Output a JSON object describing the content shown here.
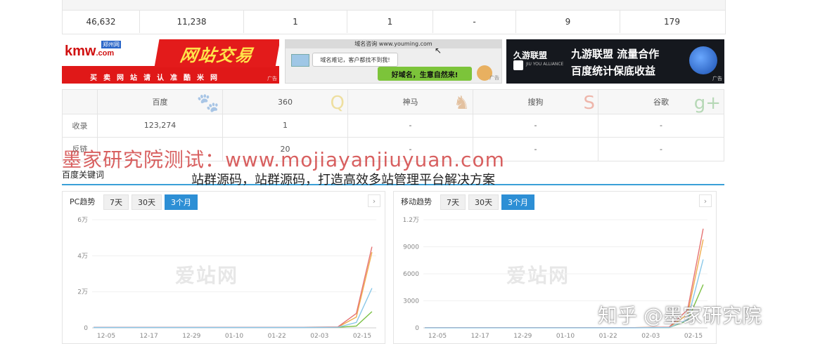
{
  "top_stats": {
    "values": [
      "46,632",
      "11,238",
      "1",
      "1",
      "-",
      "9",
      "179"
    ]
  },
  "ads": {
    "kmw": {
      "logo": "kmw",
      "city": "郑州网",
      "domain": ".com",
      "headline": "网站交易",
      "slogan": "买卖网站请认准酷米网",
      "ad_mark": "广告"
    },
    "youming": {
      "bar": "域名咨询 www.youming.com",
      "bubble": "域名难记，客户都找不到我!",
      "slogan": "好域名，生意自然来!",
      "ad_mark": "广告"
    },
    "jiuyou": {
      "brand": "久游联盟",
      "sub": "JIU YOU ALLIANCE",
      "line1": "九游联盟 流量合作",
      "line2": "百度统计保底收益",
      "ad_mark": "广告"
    }
  },
  "se_table": {
    "engines": [
      "百度",
      "360",
      "神马",
      "搜狗",
      "谷歌"
    ],
    "engine_icons": [
      "paw-icon",
      "search-q-icon",
      "shenma-icon",
      "sogou-icon",
      "google-plus-icon"
    ],
    "rows": [
      {
        "label": "收录",
        "values": [
          "123,274",
          "1",
          "-",
          "-",
          "-"
        ]
      },
      {
        "label": "反链",
        "values": [
          "-",
          "20",
          "-",
          "-",
          "-"
        ]
      }
    ]
  },
  "watermark": "墨家研究院测试：www.mojiayanjiuyuan.com",
  "article_title": "站群源码，站群源码，打造高效多站管理平台解决方案",
  "section": {
    "label": "百度关键词"
  },
  "pc_trend": {
    "title": "PC趋势",
    "tabs": [
      "7天",
      "30天",
      "3个月"
    ],
    "active_tab": "3个月",
    "watermark": "爱站网",
    "arrow": "›"
  },
  "mobile_trend": {
    "title": "移动趋势",
    "tabs": [
      "7天",
      "30天",
      "3个月"
    ],
    "active_tab": "3个月",
    "watermark": "爱站网",
    "arrow": "›"
  },
  "chart_data": [
    {
      "type": "line",
      "x": [
        "12-05",
        "12-17",
        "12-29",
        "01-10",
        "01-22",
        "02-03",
        "02-15"
      ],
      "y_ticks": [
        "0",
        "2万",
        "4万",
        "6万"
      ],
      "ylim": [
        0,
        60000
      ],
      "series": [
        {
          "color": "#7bc043",
          "values": [
            300,
            300,
            300,
            300,
            300,
            300,
            300,
            300,
            1000,
            9000
          ]
        },
        {
          "color": "#f0ad4e",
          "values": [
            300,
            300,
            300,
            300,
            300,
            300,
            300,
            400,
            6000,
            42000
          ]
        },
        {
          "color": "#e57373",
          "values": [
            300,
            300,
            300,
            300,
            300,
            300,
            300,
            500,
            8000,
            45000
          ]
        },
        {
          "color": "#8ac8e8",
          "values": [
            200,
            200,
            200,
            200,
            200,
            200,
            200,
            300,
            3000,
            22000
          ]
        }
      ]
    },
    {
      "type": "line",
      "x": [
        "12-05",
        "12-17",
        "12-29",
        "01-10",
        "01-22",
        "02-03",
        "02-15"
      ],
      "y_ticks": [
        "0",
        "3000",
        "6000",
        "9000",
        "1.2万"
      ],
      "ylim": [
        0,
        12000
      ],
      "series": [
        {
          "color": "#7bc043",
          "values": [
            20,
            20,
            20,
            20,
            20,
            20,
            20,
            40,
            800,
            4800
          ]
        },
        {
          "color": "#f0ad4e",
          "values": [
            20,
            20,
            20,
            20,
            20,
            20,
            20,
            60,
            1500,
            9800
          ]
        },
        {
          "color": "#e57373",
          "values": [
            20,
            20,
            20,
            20,
            20,
            20,
            20,
            80,
            2000,
            11000
          ]
        },
        {
          "color": "#8ac8e8",
          "values": [
            10,
            10,
            10,
            10,
            10,
            10,
            10,
            30,
            900,
            7600
          ]
        }
      ]
    }
  ]
}
